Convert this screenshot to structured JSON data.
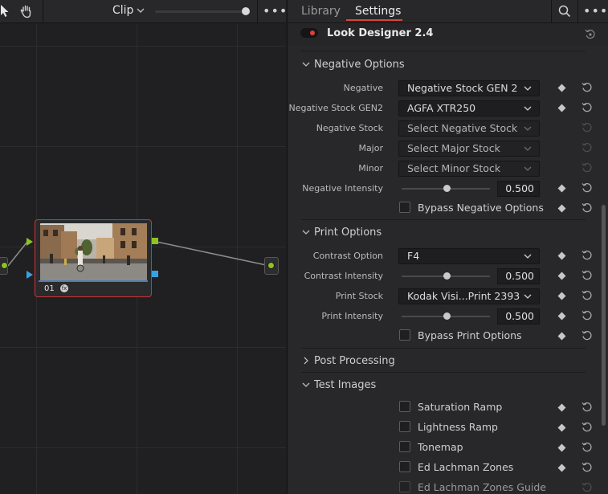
{
  "node_editor": {
    "clip_label": "Clip",
    "more_label": "•••",
    "node": {
      "label": "01",
      "fx_badge": "fx"
    }
  },
  "panel": {
    "tabs": {
      "library": "Library",
      "settings": "Settings"
    },
    "more_label": "•••",
    "plugin": {
      "title": "Look Designer 2.4",
      "enabled": true
    },
    "sections": {
      "negative": {
        "title": "Negative Options",
        "rows": {
          "negative": {
            "label": "Negative",
            "value": "Negative Stock GEN 2"
          },
          "negative_stock_gen2": {
            "label": "Negative Stock GEN2",
            "value": "AGFA XTR250"
          },
          "negative_stock": {
            "label": "Negative Stock",
            "value": "Select Negative Stock"
          },
          "major": {
            "label": "Major",
            "value": "Select Major Stock"
          },
          "minor": {
            "label": "Minor",
            "value": "Select Minor Stock"
          },
          "negative_intensity": {
            "label": "Negative Intensity",
            "value": "0.500",
            "fraction": 0.5
          },
          "bypass": {
            "label": "Bypass Negative Options",
            "checked": false
          }
        }
      },
      "print": {
        "title": "Print Options",
        "rows": {
          "contrast_option": {
            "label": "Contrast Option",
            "value": "F4"
          },
          "contrast_intensity": {
            "label": "Contrast Intensity",
            "value": "0.500",
            "fraction": 0.5
          },
          "print_stock": {
            "label": "Print Stock",
            "value": "Kodak Visi...Print 2393"
          },
          "print_intensity": {
            "label": "Print Intensity",
            "value": "0.500",
            "fraction": 0.5
          },
          "bypass": {
            "label": "Bypass Print Options",
            "checked": false
          }
        }
      },
      "post": {
        "title": "Post Processing"
      },
      "test": {
        "title": "Test Images",
        "items": [
          {
            "label": "Saturation Ramp",
            "checked": false
          },
          {
            "label": "Lightness Ramp",
            "checked": false
          },
          {
            "label": "Tonemap",
            "checked": false
          },
          {
            "label": "Ed Lachman Zones",
            "checked": false
          },
          {
            "label": "Ed Lachman Zones Guide",
            "checked": false
          }
        ]
      }
    }
  },
  "colors": {
    "accent_red": "#d6453d",
    "node_border": "#c8353a",
    "input_green": "#8fc31f",
    "input_blue": "#3aa0e0"
  }
}
